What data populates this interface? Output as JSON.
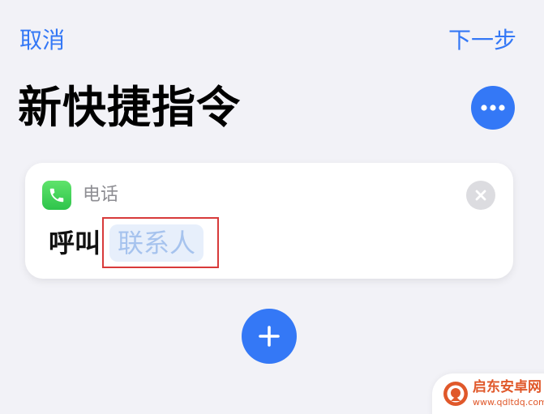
{
  "nav": {
    "cancel_label": "取消",
    "next_label": "下一步"
  },
  "header": {
    "title": "新快捷指令",
    "more_icon": "ellipsis-icon"
  },
  "action_card": {
    "app_icon": "phone-icon",
    "app_name": "电话",
    "verb": "呼叫",
    "parameter_placeholder": "联系人",
    "remove_icon": "close-icon"
  },
  "add_action": {
    "icon": "plus-icon"
  },
  "watermark": {
    "title": "启东安卓网",
    "url": "www.qdltdq.com"
  },
  "colors": {
    "accent": "#3478f6",
    "phone_green": "#34c759",
    "highlight_red": "#d83a3a",
    "watermark_orange": "#e0582a"
  }
}
